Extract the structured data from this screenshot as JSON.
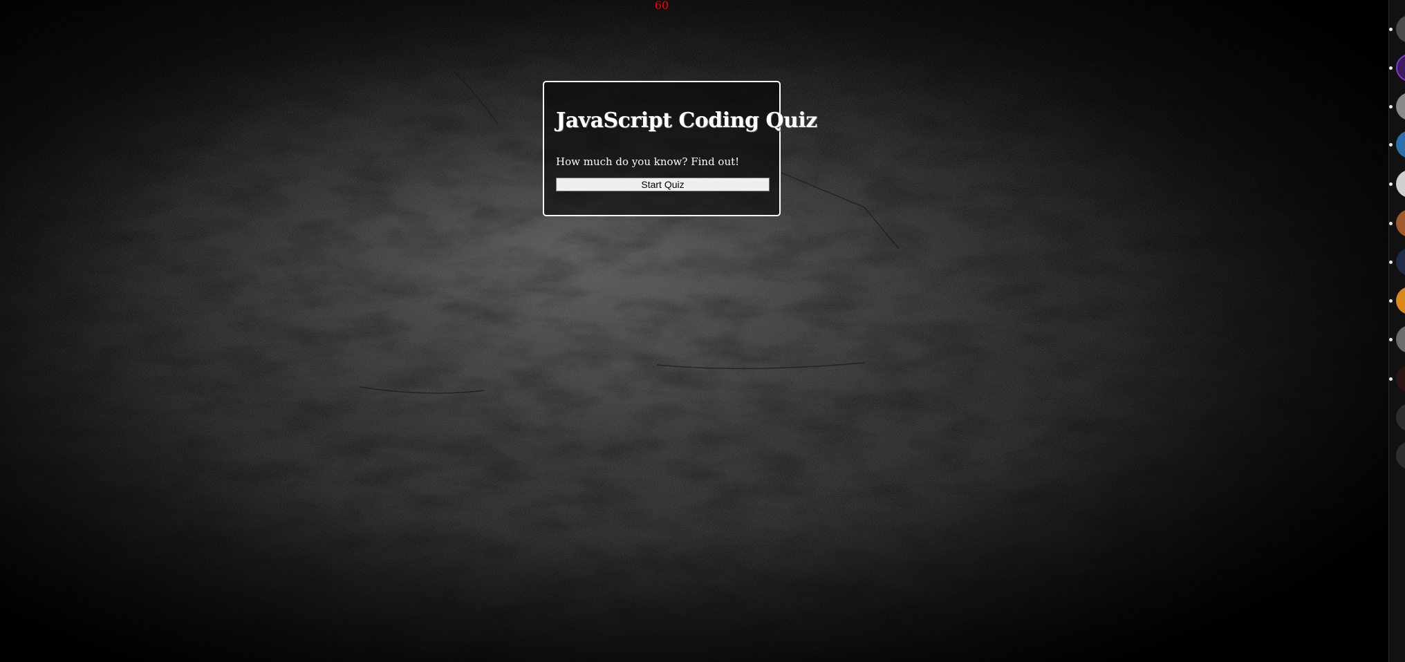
{
  "timer": {
    "value": "60"
  },
  "quiz": {
    "title": "JavaScript Coding Quiz",
    "subtitle": "How much do you know? Find out!",
    "start_label": "Start Quiz"
  },
  "colors": {
    "timer": "#ff0000",
    "card_border": "#ffffff",
    "text": "#ffffff",
    "button_bg": "#efefef"
  },
  "sidebar": {
    "items": [
      {
        "icon": "avatar-icon"
      },
      {
        "icon": "avatar-icon"
      },
      {
        "icon": "avatar-icon"
      },
      {
        "icon": "avatar-icon"
      },
      {
        "icon": "avatar-icon"
      },
      {
        "icon": "avatar-icon"
      },
      {
        "icon": "avatar-icon"
      },
      {
        "icon": "avatar-icon"
      },
      {
        "icon": "avatar-icon"
      },
      {
        "icon": "avatar-icon"
      },
      {
        "icon": "avatar-icon"
      },
      {
        "icon": "avatar-icon"
      }
    ]
  }
}
